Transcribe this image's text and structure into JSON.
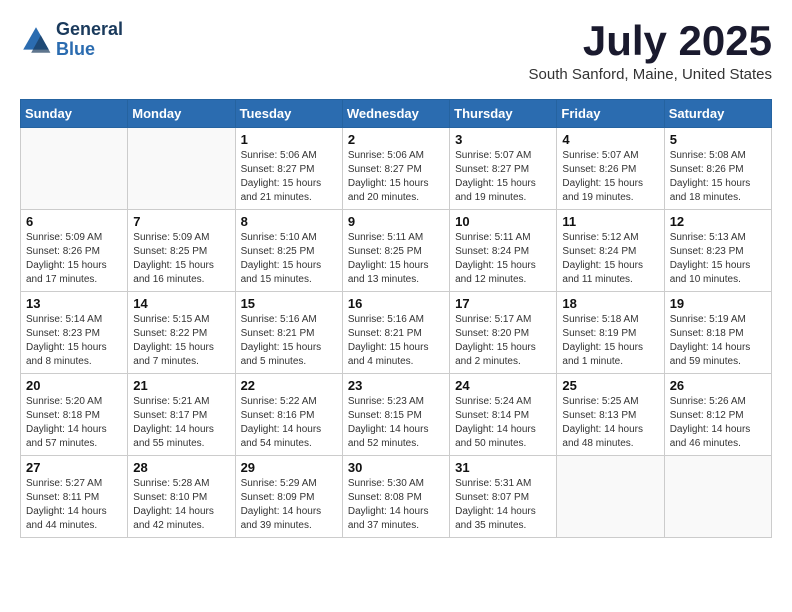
{
  "header": {
    "logo_line1": "General",
    "logo_line2": "Blue",
    "month_title": "July 2025",
    "location": "South Sanford, Maine, United States"
  },
  "days_of_week": [
    "Sunday",
    "Monday",
    "Tuesday",
    "Wednesday",
    "Thursday",
    "Friday",
    "Saturday"
  ],
  "weeks": [
    [
      {
        "day": "",
        "info": ""
      },
      {
        "day": "",
        "info": ""
      },
      {
        "day": "1",
        "info": "Sunrise: 5:06 AM\nSunset: 8:27 PM\nDaylight: 15 hours\nand 21 minutes."
      },
      {
        "day": "2",
        "info": "Sunrise: 5:06 AM\nSunset: 8:27 PM\nDaylight: 15 hours\nand 20 minutes."
      },
      {
        "day": "3",
        "info": "Sunrise: 5:07 AM\nSunset: 8:27 PM\nDaylight: 15 hours\nand 19 minutes."
      },
      {
        "day": "4",
        "info": "Sunrise: 5:07 AM\nSunset: 8:26 PM\nDaylight: 15 hours\nand 19 minutes."
      },
      {
        "day": "5",
        "info": "Sunrise: 5:08 AM\nSunset: 8:26 PM\nDaylight: 15 hours\nand 18 minutes."
      }
    ],
    [
      {
        "day": "6",
        "info": "Sunrise: 5:09 AM\nSunset: 8:26 PM\nDaylight: 15 hours\nand 17 minutes."
      },
      {
        "day": "7",
        "info": "Sunrise: 5:09 AM\nSunset: 8:25 PM\nDaylight: 15 hours\nand 16 minutes."
      },
      {
        "day": "8",
        "info": "Sunrise: 5:10 AM\nSunset: 8:25 PM\nDaylight: 15 hours\nand 15 minutes."
      },
      {
        "day": "9",
        "info": "Sunrise: 5:11 AM\nSunset: 8:25 PM\nDaylight: 15 hours\nand 13 minutes."
      },
      {
        "day": "10",
        "info": "Sunrise: 5:11 AM\nSunset: 8:24 PM\nDaylight: 15 hours\nand 12 minutes."
      },
      {
        "day": "11",
        "info": "Sunrise: 5:12 AM\nSunset: 8:24 PM\nDaylight: 15 hours\nand 11 minutes."
      },
      {
        "day": "12",
        "info": "Sunrise: 5:13 AM\nSunset: 8:23 PM\nDaylight: 15 hours\nand 10 minutes."
      }
    ],
    [
      {
        "day": "13",
        "info": "Sunrise: 5:14 AM\nSunset: 8:23 PM\nDaylight: 15 hours\nand 8 minutes."
      },
      {
        "day": "14",
        "info": "Sunrise: 5:15 AM\nSunset: 8:22 PM\nDaylight: 15 hours\nand 7 minutes."
      },
      {
        "day": "15",
        "info": "Sunrise: 5:16 AM\nSunset: 8:21 PM\nDaylight: 15 hours\nand 5 minutes."
      },
      {
        "day": "16",
        "info": "Sunrise: 5:16 AM\nSunset: 8:21 PM\nDaylight: 15 hours\nand 4 minutes."
      },
      {
        "day": "17",
        "info": "Sunrise: 5:17 AM\nSunset: 8:20 PM\nDaylight: 15 hours\nand 2 minutes."
      },
      {
        "day": "18",
        "info": "Sunrise: 5:18 AM\nSunset: 8:19 PM\nDaylight: 15 hours\nand 1 minute."
      },
      {
        "day": "19",
        "info": "Sunrise: 5:19 AM\nSunset: 8:18 PM\nDaylight: 14 hours\nand 59 minutes."
      }
    ],
    [
      {
        "day": "20",
        "info": "Sunrise: 5:20 AM\nSunset: 8:18 PM\nDaylight: 14 hours\nand 57 minutes."
      },
      {
        "day": "21",
        "info": "Sunrise: 5:21 AM\nSunset: 8:17 PM\nDaylight: 14 hours\nand 55 minutes."
      },
      {
        "day": "22",
        "info": "Sunrise: 5:22 AM\nSunset: 8:16 PM\nDaylight: 14 hours\nand 54 minutes."
      },
      {
        "day": "23",
        "info": "Sunrise: 5:23 AM\nSunset: 8:15 PM\nDaylight: 14 hours\nand 52 minutes."
      },
      {
        "day": "24",
        "info": "Sunrise: 5:24 AM\nSunset: 8:14 PM\nDaylight: 14 hours\nand 50 minutes."
      },
      {
        "day": "25",
        "info": "Sunrise: 5:25 AM\nSunset: 8:13 PM\nDaylight: 14 hours\nand 48 minutes."
      },
      {
        "day": "26",
        "info": "Sunrise: 5:26 AM\nSunset: 8:12 PM\nDaylight: 14 hours\nand 46 minutes."
      }
    ],
    [
      {
        "day": "27",
        "info": "Sunrise: 5:27 AM\nSunset: 8:11 PM\nDaylight: 14 hours\nand 44 minutes."
      },
      {
        "day": "28",
        "info": "Sunrise: 5:28 AM\nSunset: 8:10 PM\nDaylight: 14 hours\nand 42 minutes."
      },
      {
        "day": "29",
        "info": "Sunrise: 5:29 AM\nSunset: 8:09 PM\nDaylight: 14 hours\nand 39 minutes."
      },
      {
        "day": "30",
        "info": "Sunrise: 5:30 AM\nSunset: 8:08 PM\nDaylight: 14 hours\nand 37 minutes."
      },
      {
        "day": "31",
        "info": "Sunrise: 5:31 AM\nSunset: 8:07 PM\nDaylight: 14 hours\nand 35 minutes."
      },
      {
        "day": "",
        "info": ""
      },
      {
        "day": "",
        "info": ""
      }
    ]
  ]
}
